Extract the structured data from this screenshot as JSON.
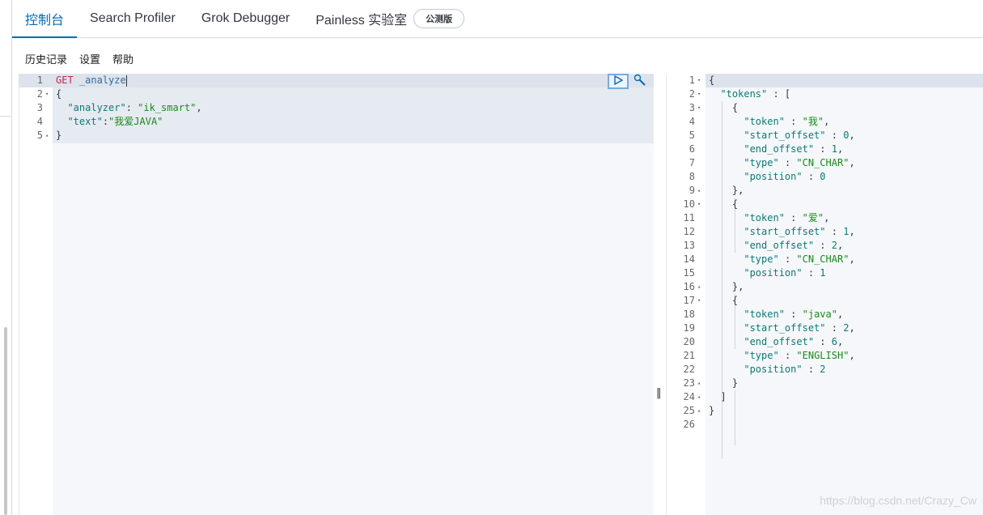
{
  "tabs": [
    {
      "label": "控制台",
      "active": true
    },
    {
      "label": "Search Profiler",
      "active": false
    },
    {
      "label": "Grok Debugger",
      "active": false
    },
    {
      "label": "Painless 实验室",
      "active": false,
      "badge": "公测版"
    }
  ],
  "toolbar": {
    "history": "历史记录",
    "settings": "设置",
    "help": "帮助"
  },
  "request": {
    "lines": [
      {
        "n": "1",
        "fold": "",
        "parts": [
          {
            "c": "tok-method",
            "t": "GET"
          },
          {
            "c": "tok-punc",
            "t": " "
          },
          {
            "c": "tok-url",
            "t": "_analyze"
          }
        ]
      },
      {
        "n": "2",
        "fold": "▾",
        "parts": [
          {
            "c": "tok-punc",
            "t": "{"
          }
        ]
      },
      {
        "n": "3",
        "fold": "",
        "parts": [
          {
            "c": "tok-punc",
            "t": "  "
          },
          {
            "c": "tok-key",
            "t": "\"analyzer\""
          },
          {
            "c": "tok-punc",
            "t": ": "
          },
          {
            "c": "tok-str",
            "t": "\"ik_smart\""
          },
          {
            "c": "tok-punc",
            "t": ","
          }
        ]
      },
      {
        "n": "4",
        "fold": "",
        "parts": [
          {
            "c": "tok-punc",
            "t": "  "
          },
          {
            "c": "tok-key",
            "t": "\"text\""
          },
          {
            "c": "tok-punc",
            "t": ":"
          },
          {
            "c": "tok-str",
            "t": "\"我爱JAVA\""
          }
        ]
      },
      {
        "n": "5",
        "fold": "▴",
        "parts": [
          {
            "c": "tok-punc",
            "t": "}"
          }
        ]
      }
    ]
  },
  "response": {
    "lines": [
      {
        "n": "1",
        "fold": "▾",
        "parts": [
          {
            "c": "tok-punc",
            "t": "{"
          }
        ]
      },
      {
        "n": "2",
        "fold": "▾",
        "parts": [
          {
            "c": "tok-punc",
            "t": "  "
          },
          {
            "c": "tok-key",
            "t": "\"tokens\""
          },
          {
            "c": "tok-punc",
            "t": " : ["
          }
        ]
      },
      {
        "n": "3",
        "fold": "▾",
        "parts": [
          {
            "c": "tok-punc",
            "t": "    {"
          }
        ]
      },
      {
        "n": "4",
        "fold": "",
        "parts": [
          {
            "c": "tok-punc",
            "t": "      "
          },
          {
            "c": "tok-key",
            "t": "\"token\""
          },
          {
            "c": "tok-punc",
            "t": " : "
          },
          {
            "c": "tok-str",
            "t": "\"我\""
          },
          {
            "c": "tok-punc",
            "t": ","
          }
        ]
      },
      {
        "n": "5",
        "fold": "",
        "parts": [
          {
            "c": "tok-punc",
            "t": "      "
          },
          {
            "c": "tok-key",
            "t": "\"start_offset\""
          },
          {
            "c": "tok-punc",
            "t": " : "
          },
          {
            "c": "tok-num",
            "t": "0"
          },
          {
            "c": "tok-punc",
            "t": ","
          }
        ]
      },
      {
        "n": "6",
        "fold": "",
        "parts": [
          {
            "c": "tok-punc",
            "t": "      "
          },
          {
            "c": "tok-key",
            "t": "\"end_offset\""
          },
          {
            "c": "tok-punc",
            "t": " : "
          },
          {
            "c": "tok-num",
            "t": "1"
          },
          {
            "c": "tok-punc",
            "t": ","
          }
        ]
      },
      {
        "n": "7",
        "fold": "",
        "parts": [
          {
            "c": "tok-punc",
            "t": "      "
          },
          {
            "c": "tok-key",
            "t": "\"type\""
          },
          {
            "c": "tok-punc",
            "t": " : "
          },
          {
            "c": "tok-str",
            "t": "\"CN_CHAR\""
          },
          {
            "c": "tok-punc",
            "t": ","
          }
        ]
      },
      {
        "n": "8",
        "fold": "",
        "parts": [
          {
            "c": "tok-punc",
            "t": "      "
          },
          {
            "c": "tok-key",
            "t": "\"position\""
          },
          {
            "c": "tok-punc",
            "t": " : "
          },
          {
            "c": "tok-num",
            "t": "0"
          }
        ]
      },
      {
        "n": "9",
        "fold": "▴",
        "parts": [
          {
            "c": "tok-punc",
            "t": "    },"
          }
        ]
      },
      {
        "n": "10",
        "fold": "▾",
        "parts": [
          {
            "c": "tok-punc",
            "t": "    {"
          }
        ]
      },
      {
        "n": "11",
        "fold": "",
        "parts": [
          {
            "c": "tok-punc",
            "t": "      "
          },
          {
            "c": "tok-key",
            "t": "\"token\""
          },
          {
            "c": "tok-punc",
            "t": " : "
          },
          {
            "c": "tok-str",
            "t": "\"爱\""
          },
          {
            "c": "tok-punc",
            "t": ","
          }
        ]
      },
      {
        "n": "12",
        "fold": "",
        "parts": [
          {
            "c": "tok-punc",
            "t": "      "
          },
          {
            "c": "tok-key",
            "t": "\"start_offset\""
          },
          {
            "c": "tok-punc",
            "t": " : "
          },
          {
            "c": "tok-num",
            "t": "1"
          },
          {
            "c": "tok-punc",
            "t": ","
          }
        ]
      },
      {
        "n": "13",
        "fold": "",
        "parts": [
          {
            "c": "tok-punc",
            "t": "      "
          },
          {
            "c": "tok-key",
            "t": "\"end_offset\""
          },
          {
            "c": "tok-punc",
            "t": " : "
          },
          {
            "c": "tok-num",
            "t": "2"
          },
          {
            "c": "tok-punc",
            "t": ","
          }
        ]
      },
      {
        "n": "14",
        "fold": "",
        "parts": [
          {
            "c": "tok-punc",
            "t": "      "
          },
          {
            "c": "tok-key",
            "t": "\"type\""
          },
          {
            "c": "tok-punc",
            "t": " : "
          },
          {
            "c": "tok-str",
            "t": "\"CN_CHAR\""
          },
          {
            "c": "tok-punc",
            "t": ","
          }
        ]
      },
      {
        "n": "15",
        "fold": "",
        "parts": [
          {
            "c": "tok-punc",
            "t": "      "
          },
          {
            "c": "tok-key",
            "t": "\"position\""
          },
          {
            "c": "tok-punc",
            "t": " : "
          },
          {
            "c": "tok-num",
            "t": "1"
          }
        ]
      },
      {
        "n": "16",
        "fold": "▴",
        "parts": [
          {
            "c": "tok-punc",
            "t": "    },"
          }
        ]
      },
      {
        "n": "17",
        "fold": "▾",
        "parts": [
          {
            "c": "tok-punc",
            "t": "    {"
          }
        ]
      },
      {
        "n": "18",
        "fold": "",
        "parts": [
          {
            "c": "tok-punc",
            "t": "      "
          },
          {
            "c": "tok-key",
            "t": "\"token\""
          },
          {
            "c": "tok-punc",
            "t": " : "
          },
          {
            "c": "tok-str",
            "t": "\"java\""
          },
          {
            "c": "tok-punc",
            "t": ","
          }
        ]
      },
      {
        "n": "19",
        "fold": "",
        "parts": [
          {
            "c": "tok-punc",
            "t": "      "
          },
          {
            "c": "tok-key",
            "t": "\"start_offset\""
          },
          {
            "c": "tok-punc",
            "t": " : "
          },
          {
            "c": "tok-num",
            "t": "2"
          },
          {
            "c": "tok-punc",
            "t": ","
          }
        ]
      },
      {
        "n": "20",
        "fold": "",
        "parts": [
          {
            "c": "tok-punc",
            "t": "      "
          },
          {
            "c": "tok-key",
            "t": "\"end_offset\""
          },
          {
            "c": "tok-punc",
            "t": " : "
          },
          {
            "c": "tok-num",
            "t": "6"
          },
          {
            "c": "tok-punc",
            "t": ","
          }
        ]
      },
      {
        "n": "21",
        "fold": "",
        "parts": [
          {
            "c": "tok-punc",
            "t": "      "
          },
          {
            "c": "tok-key",
            "t": "\"type\""
          },
          {
            "c": "tok-punc",
            "t": " : "
          },
          {
            "c": "tok-str",
            "t": "\"ENGLISH\""
          },
          {
            "c": "tok-punc",
            "t": ","
          }
        ]
      },
      {
        "n": "22",
        "fold": "",
        "parts": [
          {
            "c": "tok-punc",
            "t": "      "
          },
          {
            "c": "tok-key",
            "t": "\"position\""
          },
          {
            "c": "tok-punc",
            "t": " : "
          },
          {
            "c": "tok-num",
            "t": "2"
          }
        ]
      },
      {
        "n": "23",
        "fold": "▴",
        "parts": [
          {
            "c": "tok-punc",
            "t": "    }"
          }
        ]
      },
      {
        "n": "24",
        "fold": "▴",
        "parts": [
          {
            "c": "tok-punc",
            "t": "  ]"
          }
        ]
      },
      {
        "n": "25",
        "fold": "▴",
        "parts": [
          {
            "c": "tok-punc",
            "t": "}"
          }
        ]
      },
      {
        "n": "26",
        "fold": "",
        "parts": []
      }
    ]
  },
  "watermark": "https://blog.csdn.net/Crazy_Cw",
  "icons": {
    "run": "play-icon",
    "wrench": "wrench-icon"
  },
  "colors": {
    "accent": "#006bb4"
  }
}
